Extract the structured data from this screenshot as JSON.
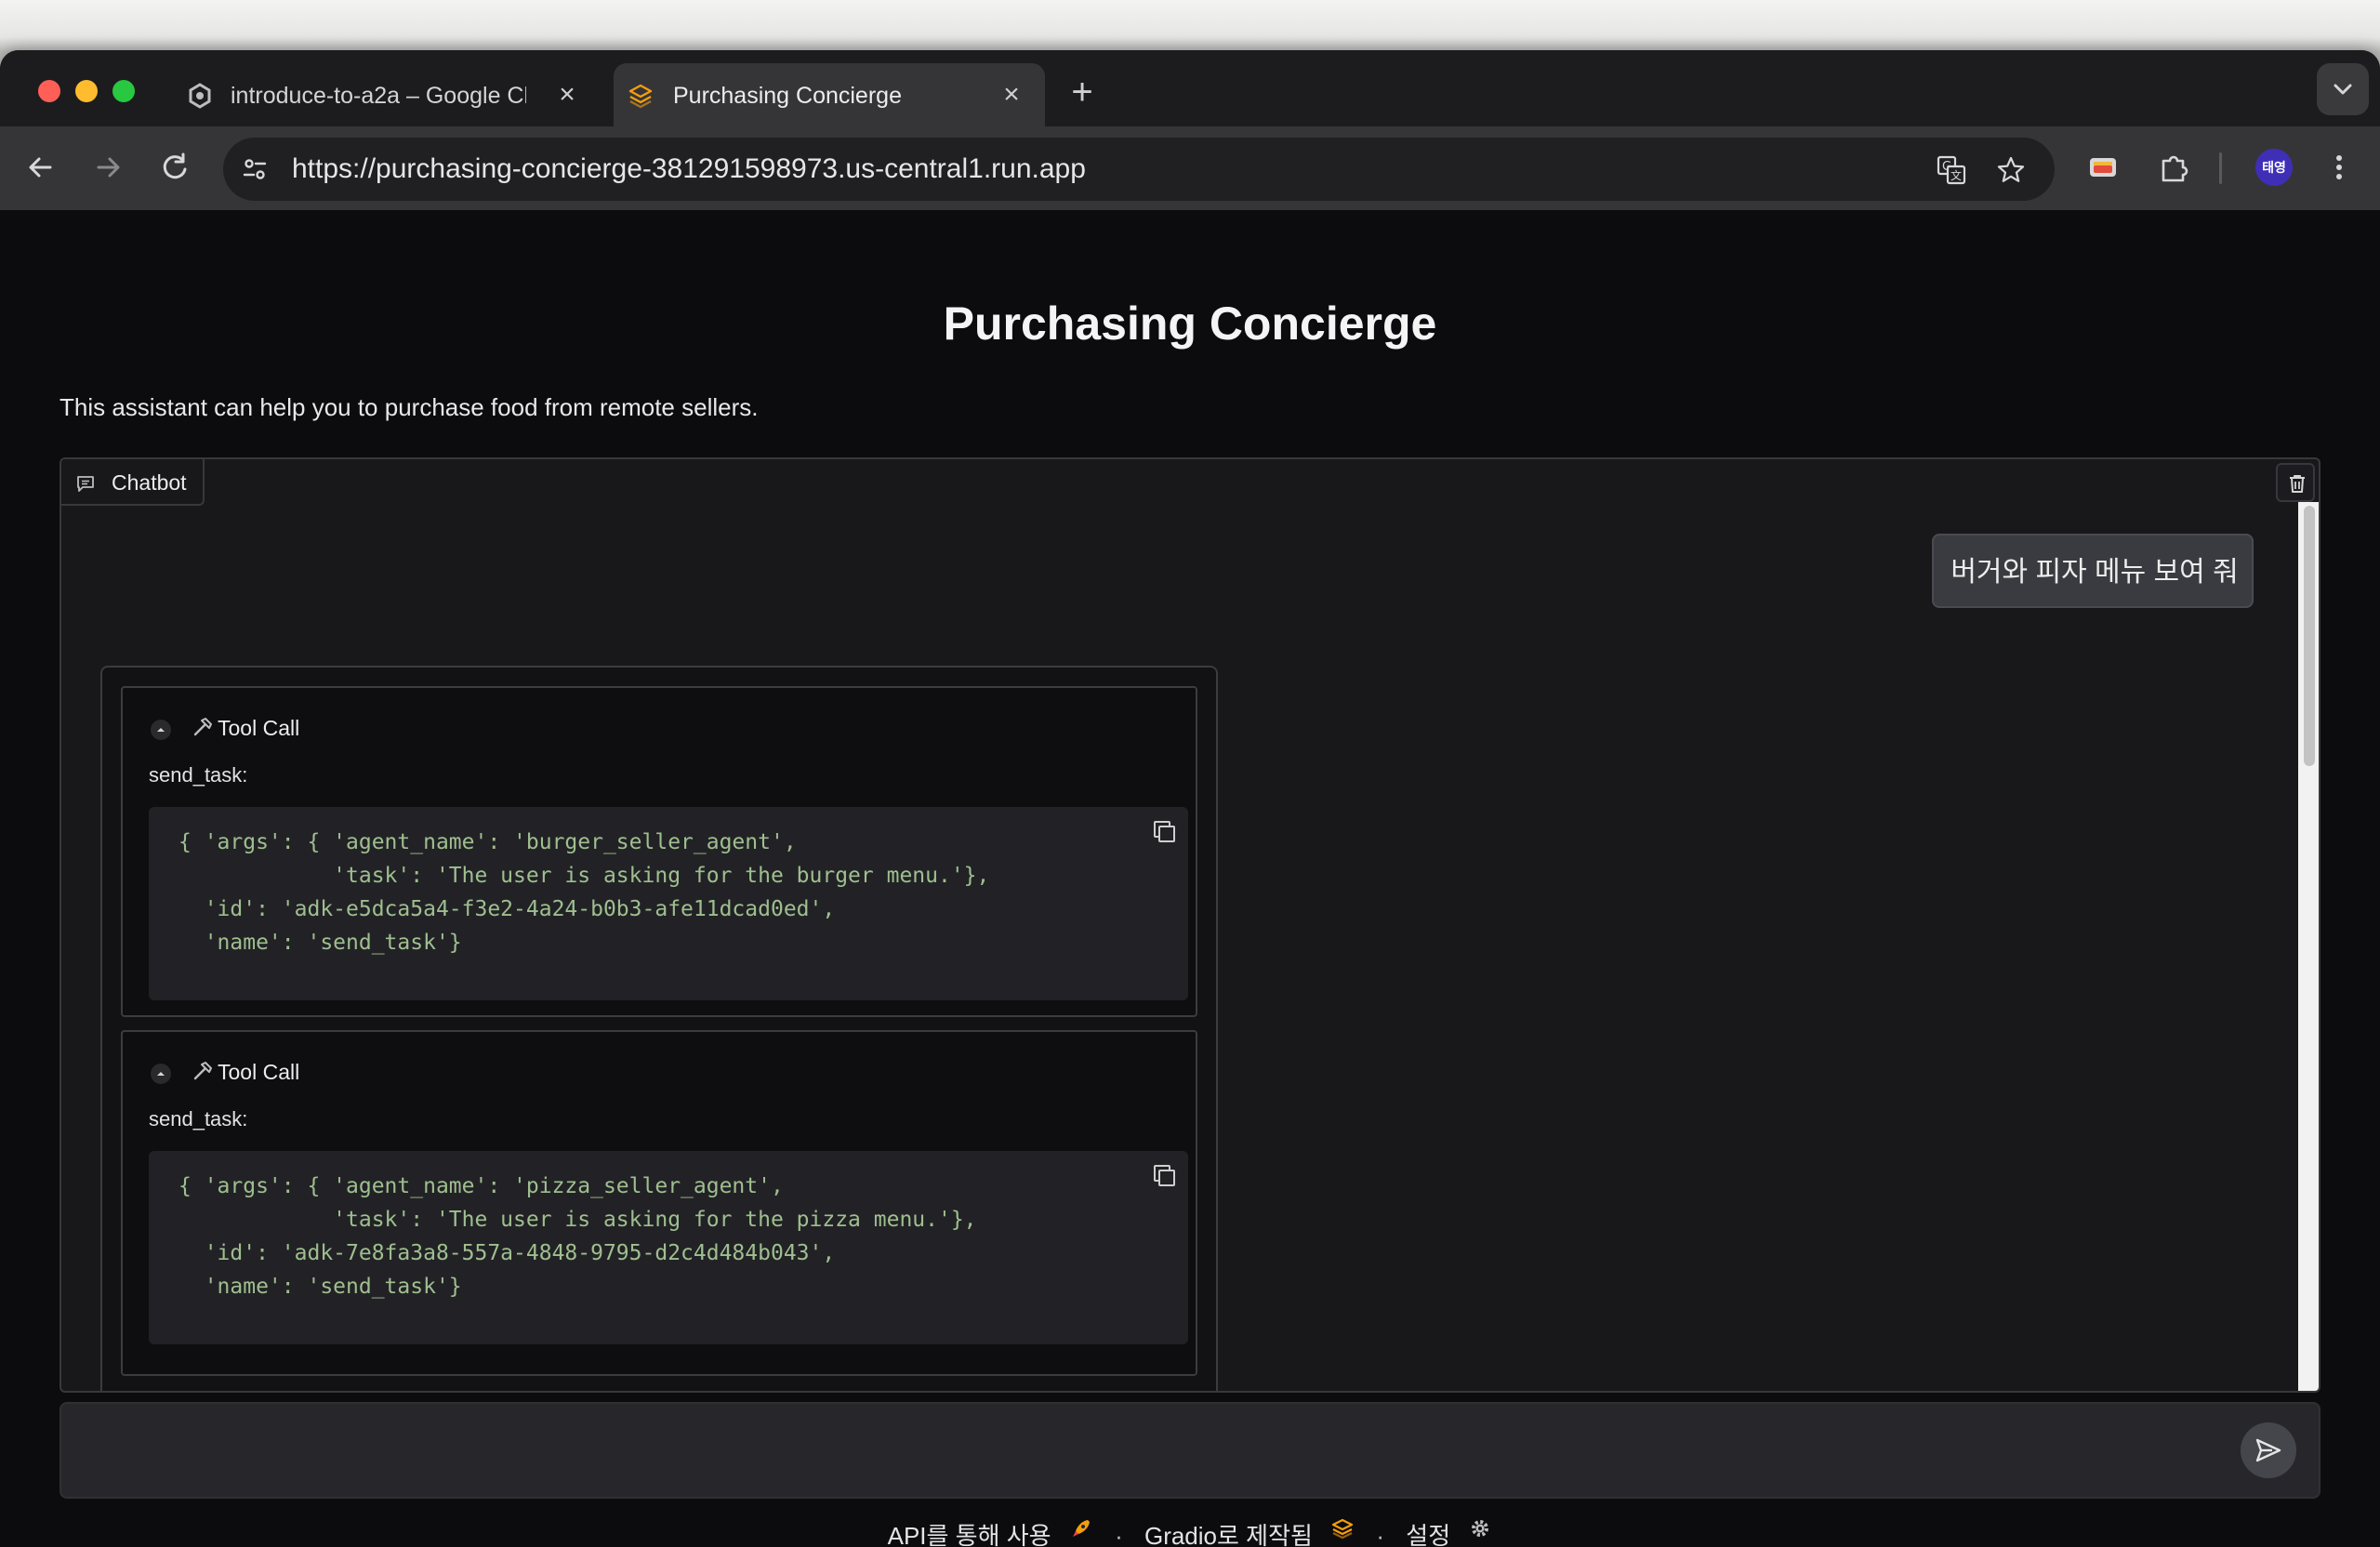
{
  "browser": {
    "tabs": [
      {
        "title": "introduce-to-a2a – Google Cl",
        "active": false,
        "icon": "google-cloud-icon"
      },
      {
        "title": "Purchasing Concierge",
        "active": true,
        "icon": "gradio-icon"
      }
    ],
    "url": "https://purchasing-concierge-381291598973.us-central1.run.app",
    "profile_initials": "태영"
  },
  "page": {
    "title": "Purchasing Concierge",
    "description": "This assistant can help you to purchase food from remote sellers."
  },
  "chatbot": {
    "label": "Chatbot",
    "user_message": "버거와 피자 메뉴 보여 줘",
    "tool_calls": [
      {
        "title": "Tool Call",
        "function": "send_task:",
        "code": [
          "{ 'args': { 'agent_name': 'burger_seller_agent',",
          "            'task': 'The user is asking for the burger menu.'},",
          "  'id': 'adk-e5dca5a4-f3e2-4a24-b0b3-afe11dcad0ed',",
          "  'name': 'send_task'}"
        ]
      },
      {
        "title": "Tool Call",
        "function": "send_task:",
        "code": [
          "{ 'args': { 'agent_name': 'pizza_seller_agent',",
          "            'task': 'The user is asking for the pizza menu.'},",
          "  'id': 'adk-7e8fa3a8-557a-4848-9795-d2c4d484b043',",
          "  'name': 'send_task'}"
        ]
      }
    ]
  },
  "input": {
    "value": "",
    "placeholder": ""
  },
  "footer": {
    "api_label": "API를 통해 사용",
    "separator": "·",
    "gradio_label": "Gradio로 제작됨",
    "settings_label": "설정"
  },
  "colors": {
    "page_bg": "#0c0c0f",
    "panel_bg": "#18181b",
    "code_string": "#9fbf8f",
    "accent": "#f97316"
  }
}
